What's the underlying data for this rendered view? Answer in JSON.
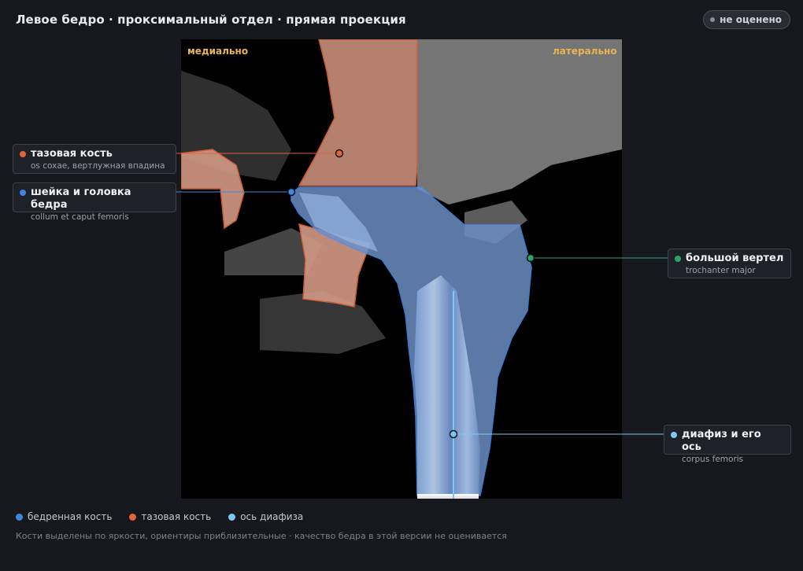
{
  "header": {
    "title": "Левое бедро · проксимальный отдел · прямая проекция",
    "status": "не оценено"
  },
  "viewer": {
    "orientation_left": "медиально",
    "orientation_right": "латерально"
  },
  "callouts": {
    "pelvis": {
      "name": "тазовая кость",
      "latin": "os coxae, вертлужная впадина",
      "color": "#e0653a"
    },
    "neck": {
      "name": "шейка и головка бедра",
      "latin": "collum et caput femoris",
      "color": "#3d86e0"
    },
    "trochanter": {
      "name": "большой вертел",
      "latin": "trochanter major",
      "color": "#2fa36b"
    },
    "shaft": {
      "name": "диафиз и его ось",
      "latin": "corpus femoris",
      "color": "#7cc8f5"
    }
  },
  "legend": [
    {
      "label": "бедренная кость",
      "color": "#3d86e0"
    },
    {
      "label": "тазовая кость",
      "color": "#e0653a"
    },
    {
      "label": "ось диафиза",
      "color": "#7cc8f5"
    }
  ],
  "note": "Кости выделены по яркости, ориентиры приблизительные · качество бедра в этой версии не оценивается"
}
